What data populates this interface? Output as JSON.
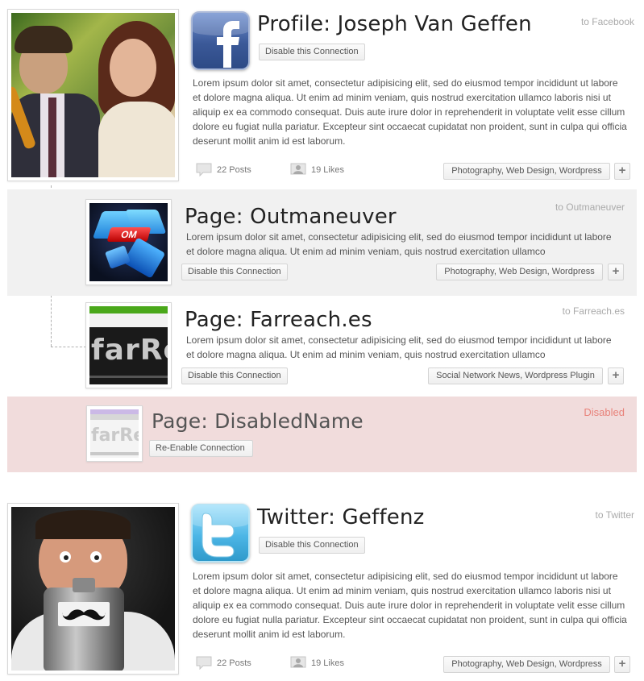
{
  "lorem_short": "Lorem ipsum dolor sit amet, consectetur adipisicing elit, sed do eiusmod tempor incididunt ut labore et dolore magna aliqua. Ut enim ad minim veniam, quis nostrud exercitation ullamco",
  "lorem_long": "Lorem ipsum dolor sit amet, consectetur adipisicing elit, sed do eiusmod tempor incididunt ut labore et dolore magna aliqua. Ut enim ad minim veniam, quis nostrud exercitation ullamco laboris nisi ut aliquip ex ea commodo consequat. Duis aute irure dolor in reprehenderit in voluptate velit esse cillum dolore eu fugiat nulla pariatur. Excepteur sint occaecat cupidatat non proident, sunt in culpa qui officia deserunt mollit anim id est laborum.",
  "facebook": {
    "title": "Profile: Joseph Van Geffen",
    "to": "to Facebook",
    "button": "Disable this Connection",
    "posts": "22 Posts",
    "likes": "19 Likes",
    "tags": "Photography, Web Design, Wordpress",
    "plus": "+",
    "logo_icon": "facebook-icon",
    "brand_color": "#3b5998"
  },
  "outmaneuver": {
    "title": "Page: Outmaneuver",
    "to": "to Outmaneuver",
    "button": "Disable this Connection",
    "tags": "Photography, Web Design, Wordpress",
    "plus": "+",
    "thumb_text": "OM"
  },
  "farreach": {
    "title": "Page: Farreach.es",
    "to": "to Farreach.es",
    "button": "Disable this Connection",
    "tags": "Social Network News, Wordpress Plugin",
    "plus": "+",
    "thumb_text": "farRe"
  },
  "disabled": {
    "title": "Page: DisabledName",
    "status": "Disabled",
    "status_color": "#e8827a",
    "button": "Re-Enable Connection",
    "thumb_text": "farRe"
  },
  "twitter": {
    "title": "Twitter: Geffenz",
    "to": "to Twitter",
    "button": "Disable this Connection",
    "posts": "22 Posts",
    "likes": "19 Likes",
    "tags": "Photography, Web Design, Wordpress",
    "plus": "+",
    "logo_icon": "twitter-icon",
    "brand_color": "#4cb6e6"
  }
}
